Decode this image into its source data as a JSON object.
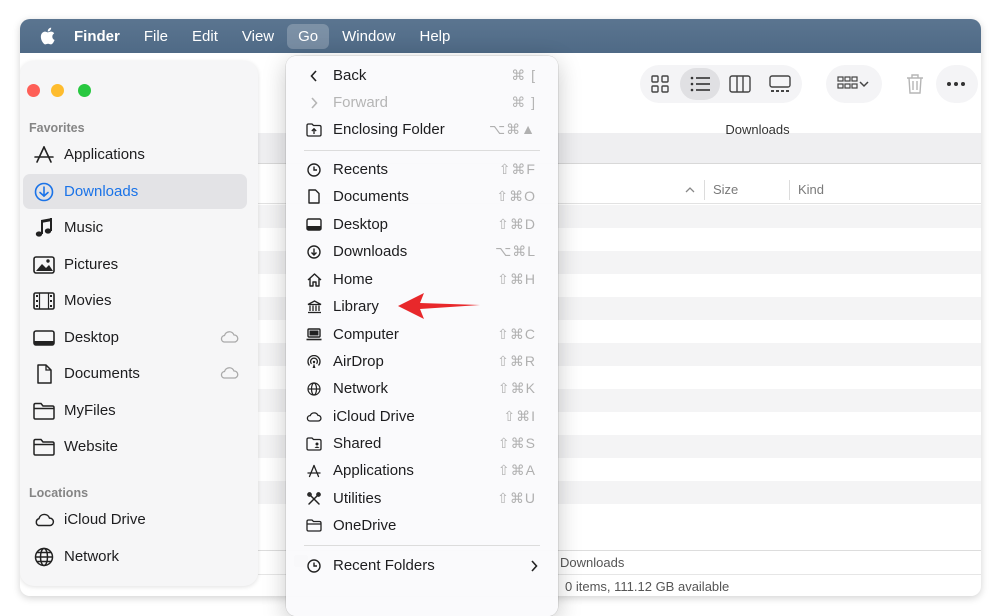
{
  "menubar": {
    "app_name": "Finder",
    "items": [
      "File",
      "Edit",
      "View",
      "Go",
      "Window",
      "Help"
    ]
  },
  "sidebar": {
    "favorites_heading": "Favorites",
    "locations_heading": "Locations",
    "favorites": [
      {
        "label": "Applications",
        "icon": "applications-icon"
      },
      {
        "label": "Downloads",
        "icon": "downloads-icon",
        "selected": true
      },
      {
        "label": "Music",
        "icon": "music-icon"
      },
      {
        "label": "Pictures",
        "icon": "pictures-icon"
      },
      {
        "label": "Movies",
        "icon": "movies-icon"
      },
      {
        "label": "Desktop",
        "icon": "desktop-icon",
        "cloud": true
      },
      {
        "label": "Documents",
        "icon": "documents-icon",
        "cloud": true
      },
      {
        "label": "MyFiles",
        "icon": "folder-icon"
      },
      {
        "label": "Website",
        "icon": "folder-icon"
      }
    ],
    "locations": [
      {
        "label": "iCloud Drive",
        "icon": "icloud-icon"
      },
      {
        "label": "Network",
        "icon": "network-icon"
      }
    ]
  },
  "window": {
    "title": "Downloads",
    "columns": {
      "size": "Size",
      "kind": "Kind"
    },
    "path_bar": "Downloads",
    "status": "0 items, 111.12 GB available"
  },
  "go_menu": {
    "items": [
      {
        "label": "Back",
        "shortcut": "⌘ [",
        "icon": "chevron-left-icon"
      },
      {
        "label": "Forward",
        "shortcut": "⌘ ]",
        "icon": "chevron-right-icon",
        "disabled": true
      },
      {
        "label": "Enclosing Folder",
        "shortcut": "⌥⌘▲",
        "icon": "enclosing-folder-icon"
      },
      {
        "label": "Recents",
        "shortcut": "⇧⌘F",
        "icon": "recents-icon"
      },
      {
        "label": "Documents",
        "shortcut": "⇧⌘O",
        "icon": "document-icon"
      },
      {
        "label": "Desktop",
        "shortcut": "⇧⌘D",
        "icon": "desktop-icon"
      },
      {
        "label": "Downloads",
        "shortcut": "⌥⌘L",
        "icon": "downloads-icon"
      },
      {
        "label": "Home",
        "shortcut": "⇧⌘H",
        "icon": "home-icon"
      },
      {
        "label": "Library",
        "shortcut": "",
        "icon": "library-icon"
      },
      {
        "label": "Computer",
        "shortcut": "⇧⌘C",
        "icon": "computer-icon"
      },
      {
        "label": "AirDrop",
        "shortcut": "⇧⌘R",
        "icon": "airdrop-icon"
      },
      {
        "label": "Network",
        "shortcut": "⇧⌘K",
        "icon": "network-icon"
      },
      {
        "label": "iCloud Drive",
        "shortcut": "⇧⌘I",
        "icon": "icloud-icon"
      },
      {
        "label": "Shared",
        "shortcut": "⇧⌘S",
        "icon": "shared-folder-icon"
      },
      {
        "label": "Applications",
        "shortcut": "⇧⌘A",
        "icon": "applications-icon"
      },
      {
        "label": "Utilities",
        "shortcut": "⇧⌘U",
        "icon": "utilities-icon"
      },
      {
        "label": "OneDrive",
        "shortcut": "",
        "icon": "folder-icon"
      },
      {
        "label": "Recent Folders",
        "shortcut": "",
        "icon": "recents-icon",
        "submenu": true
      }
    ]
  },
  "colors": {
    "menubar": "#55708c",
    "accent": "#1a73e8",
    "arrow": "#e8282b"
  }
}
